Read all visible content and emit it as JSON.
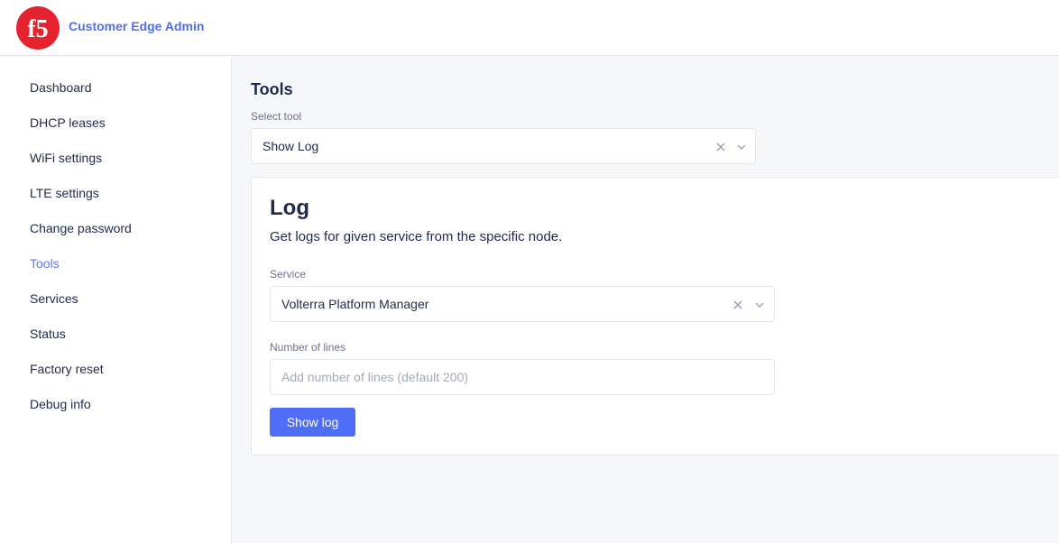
{
  "header": {
    "logo_text": "f5",
    "app_title": "Customer Edge Admin",
    "brand_color": "#e4232f",
    "accent_color": "#4f6ef0"
  },
  "sidebar": {
    "active": "Tools",
    "items": [
      {
        "label": "Dashboard"
      },
      {
        "label": "DHCP leases"
      },
      {
        "label": "WiFi settings"
      },
      {
        "label": "LTE settings"
      },
      {
        "label": "Change password"
      },
      {
        "label": "Tools"
      },
      {
        "label": "Services"
      },
      {
        "label": "Status"
      },
      {
        "label": "Factory reset"
      },
      {
        "label": "Debug info"
      }
    ]
  },
  "main": {
    "title": "Tools",
    "tool_select": {
      "label": "Select tool",
      "value": "Show Log",
      "clear_icon": "close-icon",
      "dropdown_icon": "chevron-down-icon"
    },
    "card": {
      "title": "Log",
      "description": "Get logs for given service from the specific node.",
      "service": {
        "label": "Service",
        "value": "Volterra Platform Manager"
      },
      "lines": {
        "label": "Number of lines",
        "value": "",
        "placeholder": "Add number of lines (default 200)"
      },
      "submit_label": "Show log",
      "submit_color": "#4f6ef7"
    }
  }
}
